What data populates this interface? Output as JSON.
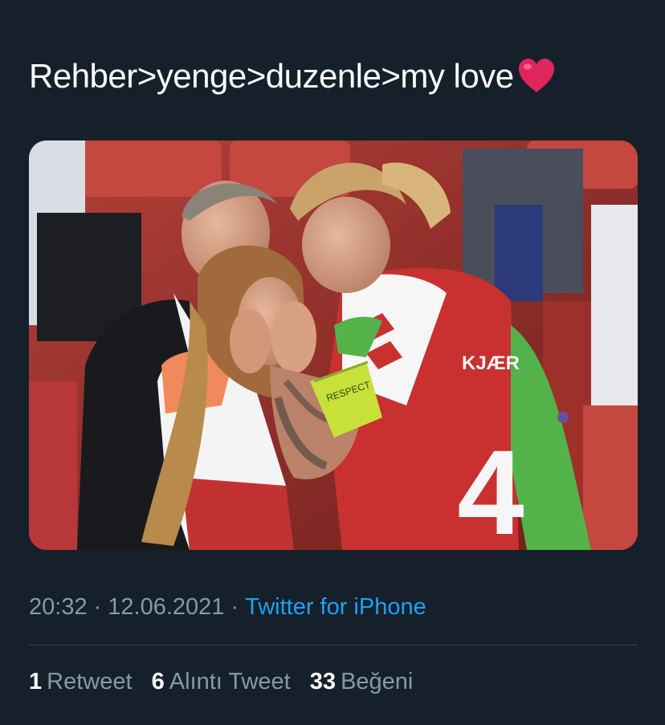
{
  "tweet": {
    "text": "Rehber>yenge>duzenle>my love",
    "emoji": "heart",
    "media": {
      "jersey_name": "KJÆR",
      "jersey_number": "4",
      "armband_text": "RESPECT"
    }
  },
  "meta": {
    "time": "20:32",
    "separator": "·",
    "date": "12.06.2021",
    "source": "Twitter for iPhone"
  },
  "stats": {
    "retweets": {
      "count": "1",
      "label": "Retweet"
    },
    "quotes": {
      "count": "6",
      "label": "Alıntı Tweet"
    },
    "likes": {
      "count": "33",
      "label": "Beğeni"
    }
  },
  "colors": {
    "background": "#15202b",
    "text": "#ffffff",
    "muted": "#8899a6",
    "link": "#1da1f2",
    "divider": "#38444d",
    "heart": "#e0245e"
  }
}
